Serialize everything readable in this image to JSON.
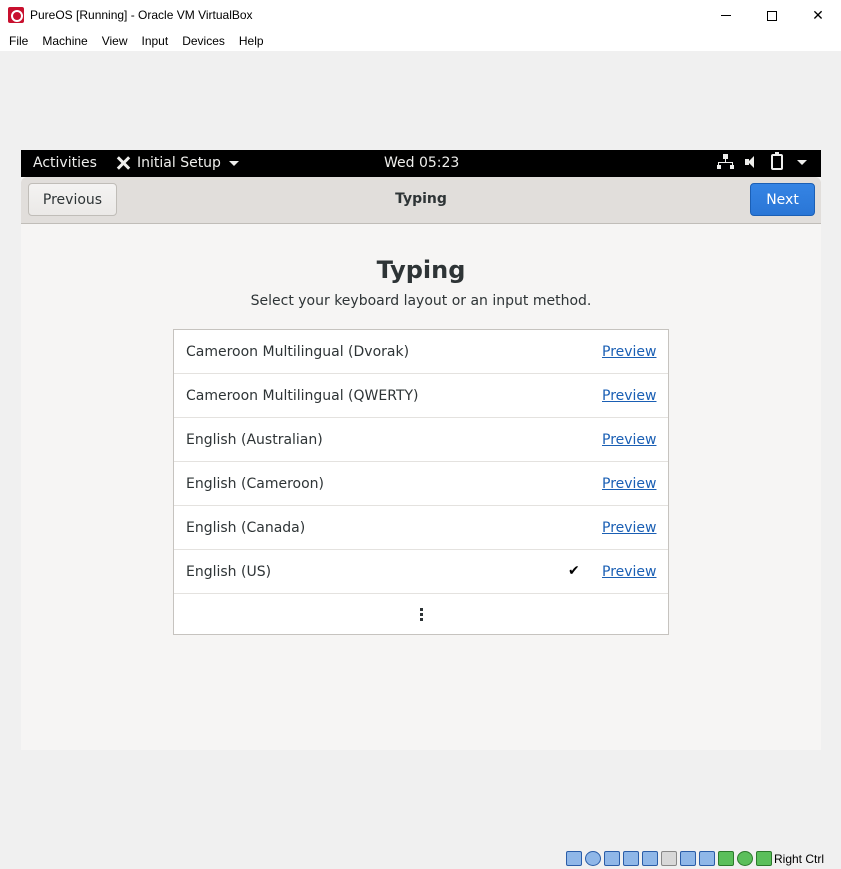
{
  "window": {
    "title": "PureOS [Running] - Oracle VM VirtualBox",
    "controls": {
      "minimize": "minimize-icon",
      "maximize": "maximize-icon",
      "close": "close-icon"
    }
  },
  "menubar": {
    "items": [
      "File",
      "Machine",
      "View",
      "Input",
      "Devices",
      "Help"
    ]
  },
  "topbar": {
    "activities": "Activities",
    "app_menu": "Initial Setup",
    "clock": "Wed 05:23"
  },
  "headerbar": {
    "previous_label": "Previous",
    "title": "Typing",
    "next_label": "Next"
  },
  "page": {
    "heading": "Typing",
    "subtitle": "Select your keyboard layout or an input method."
  },
  "layouts": [
    {
      "label": "Cameroon Multilingual (Dvorak)",
      "preview": "Preview",
      "selected": false
    },
    {
      "label": "Cameroon Multilingual (QWERTY)",
      "preview": "Preview",
      "selected": false
    },
    {
      "label": "English (Australian)",
      "preview": "Preview",
      "selected": false
    },
    {
      "label": "English (Cameroon)",
      "preview": "Preview",
      "selected": false
    },
    {
      "label": "English (Canada)",
      "preview": "Preview",
      "selected": false
    },
    {
      "label": "English (US)",
      "preview": "Preview",
      "selected": true
    }
  ],
  "statusbar": {
    "host_key": "Right Ctrl"
  },
  "colors": {
    "accent": "#3584e4",
    "link": "#1a5fb4",
    "topbar": "#000000"
  }
}
